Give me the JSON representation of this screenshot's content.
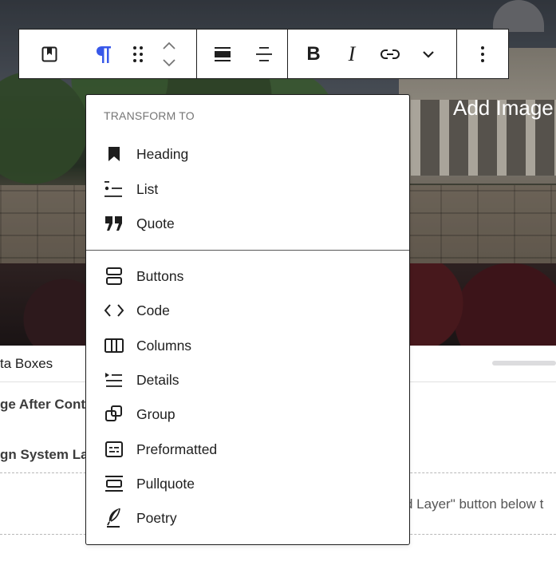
{
  "hero": {
    "overlay_text": "Add Image"
  },
  "editor": {
    "meta_boxes_label": "ta Boxes",
    "panel_row_1": "ge After Cont",
    "panel_row_2": "gn System Lay",
    "layer_hint": "d Layer\" button below t"
  },
  "toolbar": {
    "groups": [
      {
        "name": "block-type",
        "icons": [
          "bookmark-icon"
        ]
      },
      {
        "name": "block-tools",
        "icons": [
          "paragraph-icon",
          "drag-handle-icon",
          "chevron-up-icon",
          "chevron-down-icon"
        ]
      },
      {
        "name": "alignment",
        "icons": [
          "align-wide-icon",
          "align-center-icon"
        ]
      },
      {
        "name": "formatting",
        "icons": [
          "bold-icon",
          "italic-icon",
          "link-icon",
          "more-chevron-icon"
        ]
      },
      {
        "name": "options",
        "icons": [
          "more-vertical-icon"
        ]
      }
    ],
    "bold_glyph": "B",
    "italic_glyph": "I",
    "active_color": "#3858e9"
  },
  "transform_menu": {
    "heading": "TRANSFORM TO",
    "group_1": [
      {
        "label": "Heading",
        "icon": "heading-icon"
      },
      {
        "label": "List",
        "icon": "list-icon"
      },
      {
        "label": "Quote",
        "icon": "quote-icon"
      }
    ],
    "group_2": [
      {
        "label": "Buttons",
        "icon": "buttons-icon"
      },
      {
        "label": "Code",
        "icon": "code-icon"
      },
      {
        "label": "Columns",
        "icon": "columns-icon"
      },
      {
        "label": "Details",
        "icon": "details-icon"
      },
      {
        "label": "Group",
        "icon": "group-icon"
      },
      {
        "label": "Preformatted",
        "icon": "preformatted-icon"
      },
      {
        "label": "Pullquote",
        "icon": "pullquote-icon"
      },
      {
        "label": "Poetry",
        "icon": "poetry-icon"
      }
    ]
  }
}
